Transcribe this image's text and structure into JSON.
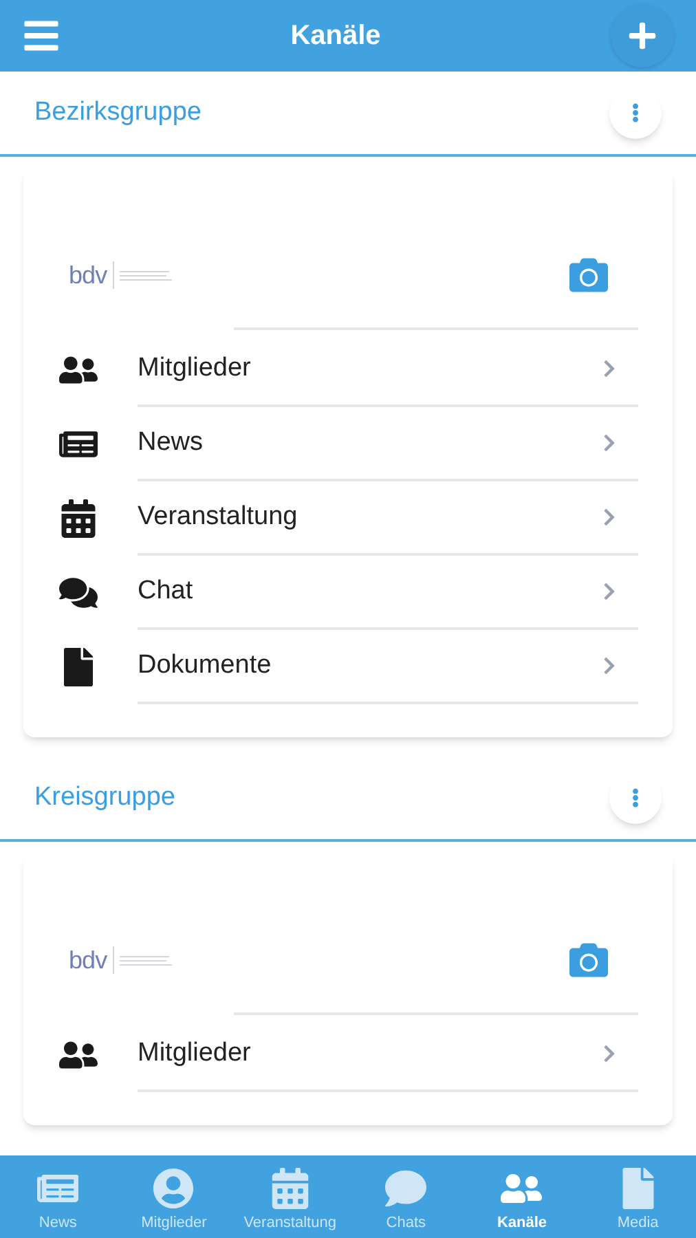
{
  "header": {
    "title": "Kanäle"
  },
  "groups": [
    {
      "title": "Bezirksgruppe",
      "logo": "bdv",
      "items": [
        {
          "kind": "members",
          "label": "Mitglieder"
        },
        {
          "kind": "news",
          "label": "News"
        },
        {
          "kind": "events",
          "label": "Veranstaltung"
        },
        {
          "kind": "chat",
          "label": "Chat"
        },
        {
          "kind": "documents",
          "label": "Dokumente"
        }
      ]
    },
    {
      "title": "Kreisgruppe",
      "logo": "bdv",
      "items": [
        {
          "kind": "members",
          "label": "Mitglieder"
        }
      ]
    }
  ],
  "bottom_nav": [
    {
      "kind": "news",
      "label": "News",
      "selected": false
    },
    {
      "kind": "profile",
      "label": "Mitglieder",
      "selected": false
    },
    {
      "kind": "events",
      "label": "Veranstaltung",
      "selected": false
    },
    {
      "kind": "chat",
      "label": "Chats",
      "selected": false
    },
    {
      "kind": "members",
      "label": "Kanäle",
      "selected": true
    },
    {
      "kind": "documents",
      "label": "Media",
      "selected": false
    }
  ]
}
